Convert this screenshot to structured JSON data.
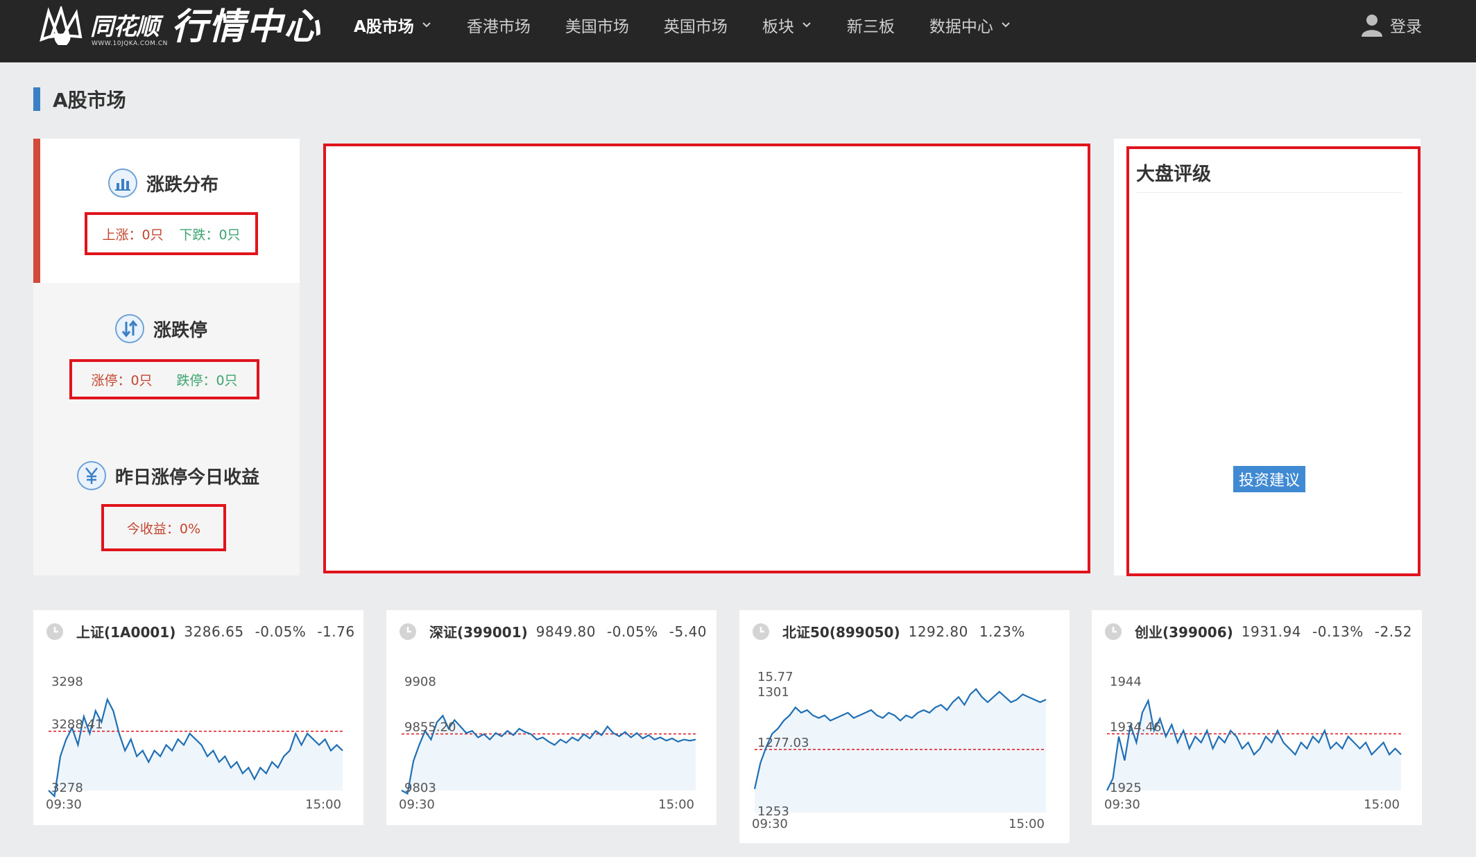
{
  "header": {
    "brand": "同花顺",
    "brand_sub": "WWW.10JQKA.COM.CN",
    "title": "行情中心",
    "nav": [
      {
        "label": "A股市场",
        "dropdown": true,
        "active": true
      },
      {
        "label": "香港市场",
        "dropdown": false
      },
      {
        "label": "美国市场",
        "dropdown": false
      },
      {
        "label": "英国市场",
        "dropdown": false
      },
      {
        "label": "板块",
        "dropdown": true
      },
      {
        "label": "新三板",
        "dropdown": false
      },
      {
        "label": "数据中心",
        "dropdown": true
      }
    ],
    "login": "登录"
  },
  "page": {
    "title": "A股市场"
  },
  "stats": {
    "distribution": {
      "title": "涨跌分布",
      "up": "上涨：0只",
      "down": "下跌：0只"
    },
    "limit": {
      "title": "涨跌停",
      "up": "涨停：0只",
      "down": "跌停：0只"
    },
    "yesterday": {
      "title": "昨日涨停今日收益",
      "value": "今收益：0%"
    }
  },
  "rating": {
    "title": "大盘评级",
    "button": "投资建议"
  },
  "colors": {
    "up": "#c4452f",
    "down": "#3aa36e",
    "line": "#1f6fb5",
    "accent": "#3b7fc4",
    "highlight": "#e0141c"
  },
  "indices": [
    {
      "name": "上证(1A0001)",
      "price": "3286.65",
      "pct": "-0.05%",
      "chg": "-1.76",
      "y_high": "3298",
      "y_mid": "3288.41",
      "y_low": "3278",
      "t_start": "09:30",
      "t_end": "15:00",
      "ymin": 3278,
      "ymax": 3298,
      "ref": 3288.41,
      "series": [
        3278,
        3277,
        3284,
        3287,
        3289,
        3286,
        3291,
        3288,
        3292,
        3290,
        3294,
        3292,
        3288,
        3285,
        3287,
        3284,
        3285,
        3283,
        3285,
        3284,
        3286,
        3285,
        3287,
        3286,
        3288,
        3287,
        3286,
        3284,
        3285,
        3283,
        3284,
        3282,
        3283,
        3281,
        3282,
        3280,
        3282,
        3281,
        3283,
        3282,
        3284,
        3285,
        3288,
        3286,
        3288,
        3287,
        3286,
        3287,
        3285,
        3286,
        3285
      ]
    },
    {
      "name": "深证(399001)",
      "price": "9849.80",
      "pct": "-0.05%",
      "chg": "-5.40",
      "y_high": "9908",
      "y_mid": "9855.20",
      "y_low": "9803",
      "t_start": "09:30",
      "t_end": "15:00",
      "ymin": 9803,
      "ymax": 9908,
      "ref": 9855.2,
      "series": [
        9803,
        9800,
        9830,
        9845,
        9858,
        9850,
        9866,
        9872,
        9860,
        9868,
        9862,
        9856,
        9858,
        9852,
        9855,
        9850,
        9856,
        9853,
        9858,
        9854,
        9860,
        9857,
        9855,
        9850,
        9852,
        9848,
        9845,
        9850,
        9847,
        9852,
        9849,
        9855,
        9851,
        9858,
        9854,
        9862,
        9856,
        9853,
        9857,
        9852,
        9856,
        9851,
        9854,
        9850,
        9852,
        9849,
        9851,
        9848,
        9850,
        9849,
        9850
      ]
    },
    {
      "name": "北证50(899050)",
      "price": "1292.80",
      "pct": "1.23%",
      "chg": "",
      "y_top": "15.77",
      "y_high": "1301",
      "y_mid": "1277.03",
      "y_low": "1253",
      "t_start": "09:30",
      "t_end": "15:00",
      "ymin": 1253,
      "ymax": 1301,
      "ref": 1277.03,
      "series": [
        1262,
        1272,
        1278,
        1283,
        1285,
        1288,
        1290,
        1293,
        1291,
        1292,
        1290,
        1289,
        1290,
        1288,
        1289,
        1290,
        1291,
        1289,
        1290,
        1291,
        1292,
        1290,
        1289,
        1291,
        1290,
        1288,
        1290,
        1289,
        1291,
        1292,
        1291,
        1293,
        1294,
        1292,
        1295,
        1297,
        1294,
        1298,
        1300,
        1297,
        1295,
        1297,
        1299,
        1297,
        1295,
        1296,
        1298,
        1297,
        1296,
        1295,
        1296
      ]
    },
    {
      "name": "创业(399006)",
      "price": "1931.94",
      "pct": "-0.13%",
      "chg": "-2.52",
      "y_high": "1944",
      "y_mid": "1934.46",
      "y_low": "1925",
      "t_start": "09:30",
      "t_end": "15:00",
      "ymin": 1925,
      "ymax": 1944,
      "ref": 1934.46,
      "series": [
        1925,
        1927,
        1934,
        1930,
        1936,
        1933,
        1938,
        1940,
        1935,
        1937,
        1934,
        1936,
        1933,
        1935,
        1932,
        1934,
        1933,
        1935,
        1932,
        1934,
        1933,
        1935,
        1934,
        1932,
        1933,
        1931,
        1932,
        1934,
        1933,
        1935,
        1933,
        1932,
        1931,
        1933,
        1932,
        1934,
        1933,
        1935,
        1932,
        1933,
        1932,
        1934,
        1933,
        1932,
        1933,
        1931,
        1932,
        1933,
        1931,
        1932,
        1931
      ]
    }
  ]
}
